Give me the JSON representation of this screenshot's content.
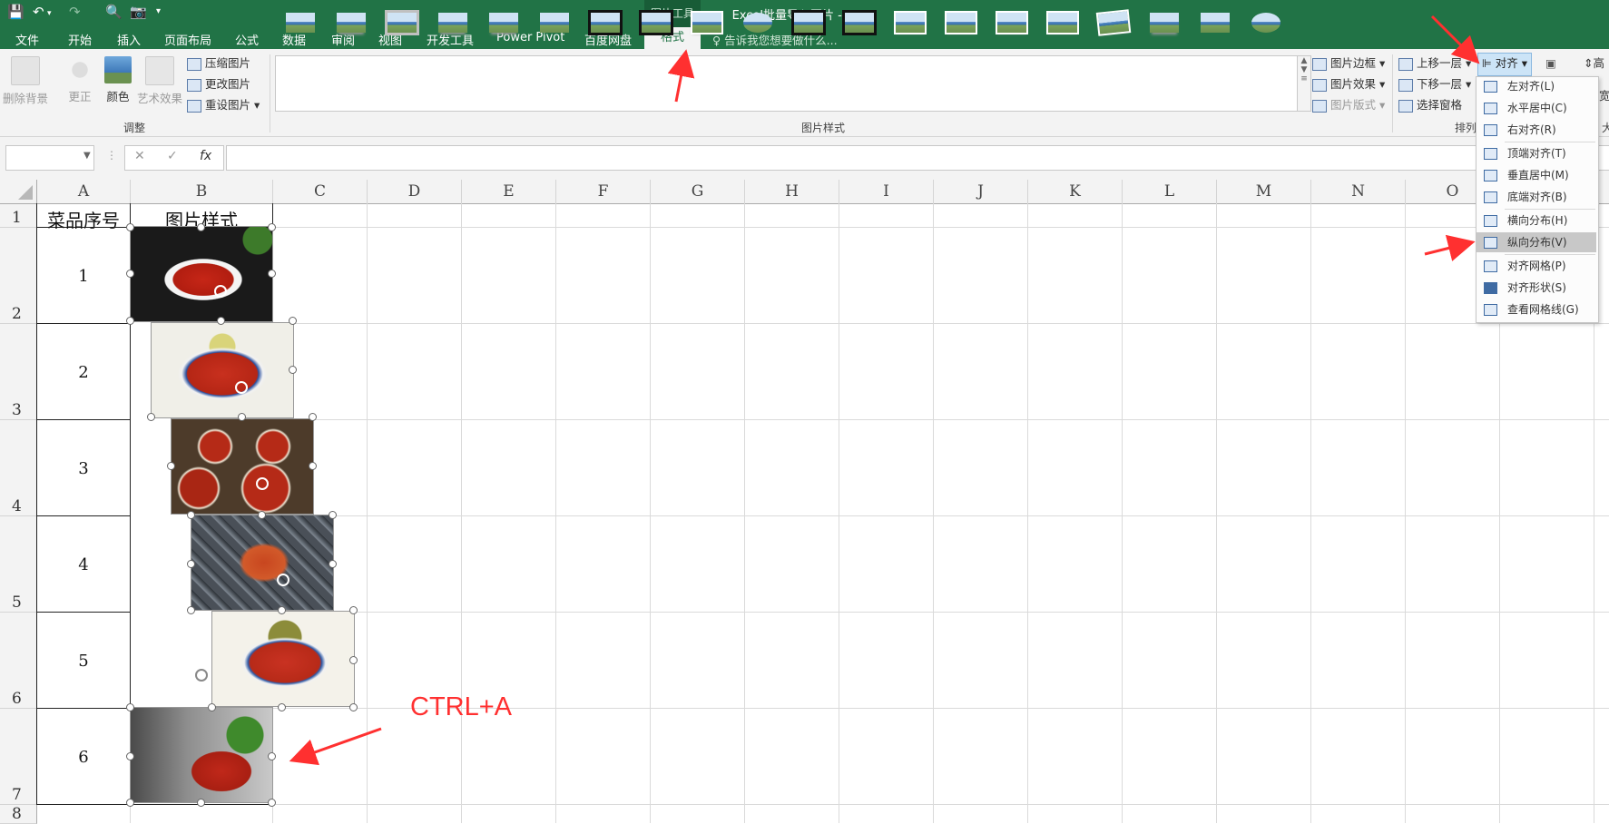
{
  "titlebar": {
    "title": "Excel批量导入图片 - Excel",
    "context_tab_group": "图片工具"
  },
  "ribbon_tabs": [
    "文件",
    "开始",
    "插入",
    "页面布局",
    "公式",
    "数据",
    "审阅",
    "视图",
    "开发工具",
    "Power Pivot",
    "百度网盘",
    "格式"
  ],
  "tell_me": "告诉我您想要做什么...",
  "ribbon": {
    "remove_bg": "删除背景",
    "corrections": "更正",
    "color": "颜色",
    "artistic": "艺术效果",
    "compress": "压缩图片",
    "change": "更改图片",
    "reset": "重设图片",
    "adjust_group": "调整",
    "styles_group": "图片样式",
    "border": "图片边框",
    "effects": "图片效果",
    "layout": "图片版式",
    "bring_forward": "上移一层",
    "send_backward": "下移一层",
    "selection_pane": "选择窗格",
    "arrange_group": "排列",
    "align": "对齐",
    "height_label": "高",
    "width_label": "宽",
    "size_group": "大"
  },
  "align_menu": [
    {
      "label": "左对齐(L)",
      "icon": "align-left-icon"
    },
    {
      "label": "水平居中(C)",
      "icon": "align-center-icon"
    },
    {
      "label": "右对齐(R)",
      "icon": "align-right-icon"
    },
    {
      "label": "顶端对齐(T)",
      "icon": "align-top-icon"
    },
    {
      "label": "垂直居中(M)",
      "icon": "align-middle-icon"
    },
    {
      "label": "底端对齐(B)",
      "icon": "align-bottom-icon"
    },
    {
      "label": "横向分布(H)",
      "icon": "distribute-horizontal-icon"
    },
    {
      "label": "纵向分布(V)",
      "icon": "distribute-vertical-icon"
    },
    {
      "label": "对齐网格(P)",
      "icon": "snap-grid-icon"
    },
    {
      "label": "对齐形状(S)",
      "icon": "snap-shape-icon"
    },
    {
      "label": "查看网格线(G)",
      "icon": "view-gridlines-icon"
    }
  ],
  "formula_bar": {
    "name_box": "",
    "fx": "fx",
    "formula": ""
  },
  "columns": [
    "A",
    "B",
    "C",
    "D",
    "E",
    "F",
    "G",
    "H",
    "I",
    "J",
    "K",
    "L",
    "M",
    "N",
    "O"
  ],
  "rows": [
    "1",
    "2",
    "3",
    "4",
    "5",
    "6",
    "7",
    "8"
  ],
  "sheet": {
    "header_a": "菜品序号",
    "header_b": "图片样式",
    "numbers": [
      "1",
      "2",
      "3",
      "4",
      "5",
      "6"
    ]
  },
  "annotation": {
    "hint": "CTRL+A"
  },
  "colors": {
    "excel_green": "#217346",
    "arrow_red": "#ff3030"
  }
}
